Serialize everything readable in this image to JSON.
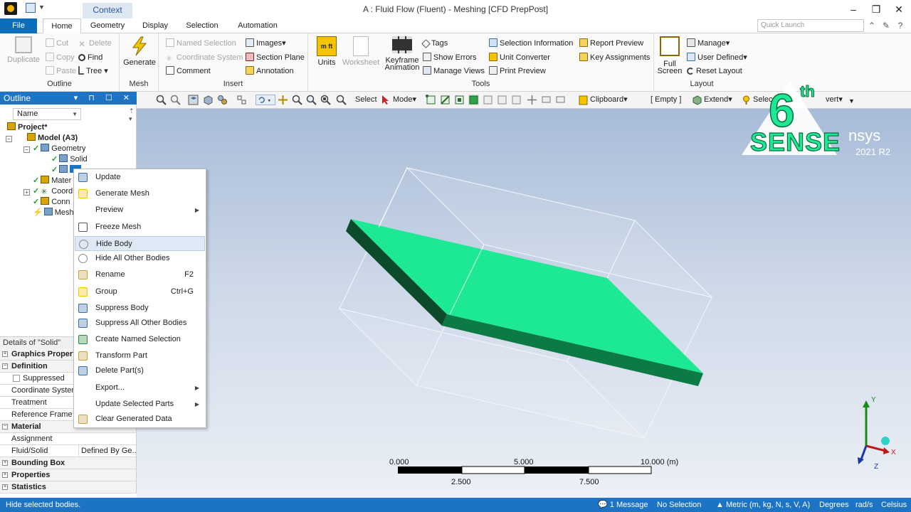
{
  "window": {
    "title": "A : Fluid Flow (Fluent) - Meshing [CFD PrepPost]",
    "context_tab": "Context"
  },
  "tabs": {
    "file": "File",
    "items": [
      "Home",
      "Geometry",
      "Display",
      "Selection",
      "Automation"
    ],
    "active": "Home",
    "quick_launch_placeholder": "Quick Launch"
  },
  "ribbon": {
    "outline_group": {
      "label": "Outline",
      "duplicate": "Duplicate",
      "cut": "Cut",
      "copy": "Copy",
      "paste": "Paste",
      "delete": "Delete",
      "find": "Find",
      "tree": "Tree"
    },
    "mesh_group": {
      "label": "Mesh",
      "generate": "Generate"
    },
    "insert_group": {
      "label": "Insert",
      "named_selection": "Named Selection",
      "coordinate_system": "Coordinate System",
      "comment": "Comment",
      "images": "Images",
      "section_plane": "Section Plane",
      "annotation": "Annotation"
    },
    "tools_group": {
      "label": "Tools",
      "units": "Units",
      "units_icon_text": "m ft",
      "worksheet": "Worksheet",
      "keyframe_1": "Keyframe",
      "keyframe_2": "Animation",
      "tags": "Tags",
      "show_errors": "Show Errors",
      "manage_views": "Manage Views",
      "selection_information": "Selection Information",
      "unit_converter": "Unit Converter",
      "print_preview": "Print Preview",
      "report_preview": "Report Preview",
      "key_assignments": "Key Assignments"
    },
    "layout_group": {
      "label": "Layout",
      "full_1": "Full",
      "full_2": "Screen",
      "manage": "Manage",
      "user_defined": "User Defined",
      "reset_layout": "Reset Layout"
    }
  },
  "outline": {
    "title": "Outline",
    "name_column": "Name",
    "tree": {
      "project": "Project*",
      "model": "Model (A3)",
      "geometry": "Geometry",
      "solid": "Solid",
      "materials": "Mater",
      "coordinates": "Coord",
      "connections": "Conn",
      "mesh": "Mesh"
    }
  },
  "details": {
    "title": "Details of \"Solid\"",
    "rows": {
      "graphics_properties": "Graphics Properti",
      "definition": "Definition",
      "suppressed": "Suppressed",
      "coordinate_system": "Coordinate System",
      "treatment": "Treatment",
      "reference_frame": "Reference Frame",
      "material": "Material",
      "assignment": "Assignment",
      "fluid_solid": "Fluid/Solid",
      "fluid_solid_value": "Defined By Ge...",
      "bounding_box": "Bounding Box",
      "properties": "Properties",
      "statistics": "Statistics"
    }
  },
  "graphics_toolbar": {
    "select": "Select",
    "mode": "Mode",
    "clipboard": "Clipboard",
    "empty": "[ Empty ]",
    "extend": "Extend",
    "select_2": "Selec",
    "convert": "vert"
  },
  "context_menu": {
    "items": [
      {
        "label": "Update",
        "shortcut": "",
        "submenu": false
      },
      {
        "label": "Generate Mesh",
        "shortcut": "",
        "submenu": false
      },
      {
        "label": "Preview",
        "shortcut": "",
        "submenu": true
      },
      {
        "label": "Freeze Mesh",
        "shortcut": "",
        "submenu": false
      },
      {
        "label": "Hide Body",
        "shortcut": "",
        "submenu": false
      },
      {
        "label": "Hide All Other Bodies",
        "shortcut": "",
        "submenu": false
      },
      {
        "label": "Rename",
        "shortcut": "F2",
        "submenu": false
      },
      {
        "label": "Group",
        "shortcut": "Ctrl+G",
        "submenu": false
      },
      {
        "label": "Suppress Body",
        "shortcut": "",
        "submenu": false
      },
      {
        "label": "Suppress All Other Bodies",
        "shortcut": "",
        "submenu": false
      },
      {
        "label": "Create Named Selection",
        "shortcut": "",
        "submenu": false
      },
      {
        "label": "Transform Part",
        "shortcut": "",
        "submenu": false
      },
      {
        "label": "Delete Part(s)",
        "shortcut": "",
        "submenu": false
      },
      {
        "label": "Export...",
        "shortcut": "",
        "submenu": true
      },
      {
        "label": "Update Selected Parts",
        "shortcut": "",
        "submenu": true
      },
      {
        "label": "Clear Generated Data",
        "shortcut": "",
        "submenu": false
      }
    ],
    "hovered_index": 4
  },
  "viewport": {
    "body_color": "#1de894",
    "body_side_color": "#0c7a45",
    "body_dark_color": "#0b4a2b",
    "scale": {
      "top_labels": [
        "0.000",
        "5.000",
        "10.000 (m)"
      ],
      "bottom_labels": [
        "2.500",
        "7.500"
      ]
    },
    "axes": {
      "x": "X",
      "y": "Y",
      "z": "Z"
    },
    "watermark": {
      "number": "6",
      "suffix": "th",
      "word": "SENSE",
      "brand": "nsys",
      "version": "2021 R2"
    }
  },
  "statusbar": {
    "message": "Hide selected bodies.",
    "messages": "1 Message",
    "selection": "No Selection",
    "units": "Metric (m, kg, N, s, V, A)",
    "degrees": "Degrees",
    "rad_s": "rad/s",
    "celsius": "Celsius"
  },
  "colors": {
    "accent_blue": "#1d74c4",
    "file_tab": "#0a6ebd",
    "logo_green": "#1de894"
  }
}
